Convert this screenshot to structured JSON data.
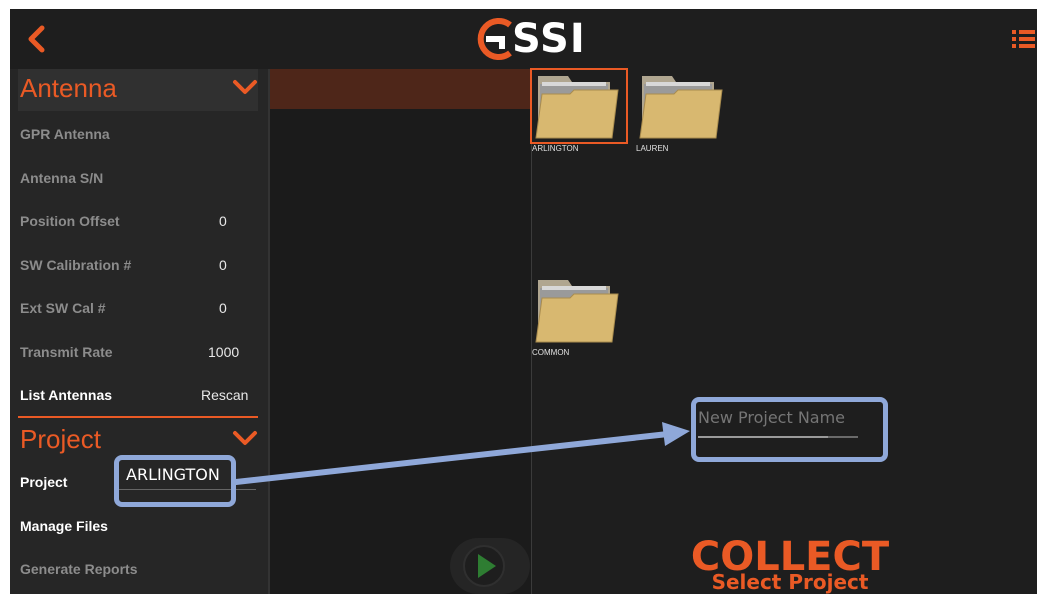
{
  "header": {
    "back_icon": "chevron-left-icon",
    "logo_text": "SSI",
    "logo_mark": "G",
    "menu_icon": "list-menu-icon"
  },
  "sidebar": {
    "antenna_section": {
      "title": "Antenna",
      "rows": [
        {
          "label": "GPR Antenna",
          "value": ""
        },
        {
          "label": "Antenna S/N",
          "value": ""
        },
        {
          "label": "Position Offset",
          "value": "0"
        },
        {
          "label": "SW Calibration #",
          "value": "0"
        },
        {
          "label": "Ext SW Cal #",
          "value": "0"
        },
        {
          "label": "Transmit Rate",
          "value": "1000"
        },
        {
          "label": "List Antennas",
          "value": "Rescan"
        }
      ]
    },
    "project_section": {
      "title": "Project",
      "project_label": "Project",
      "project_value": "ARLINGTON",
      "manage_files": "Manage Files",
      "generate_reports": "Generate Reports"
    }
  },
  "folders": [
    {
      "name": "ARLINGTON",
      "selected": true
    },
    {
      "name": "LAUREN",
      "selected": false
    },
    {
      "name": "COMMON",
      "selected": false
    }
  ],
  "new_project": {
    "placeholder": "New Project Name"
  },
  "collect": {
    "title": "COLLECT",
    "subtitle": "Select Project"
  },
  "colors": {
    "accent": "#ea5a25",
    "highlight": "#8fa8d9",
    "background": "#1e1e1e",
    "folder": "#d8b870"
  }
}
